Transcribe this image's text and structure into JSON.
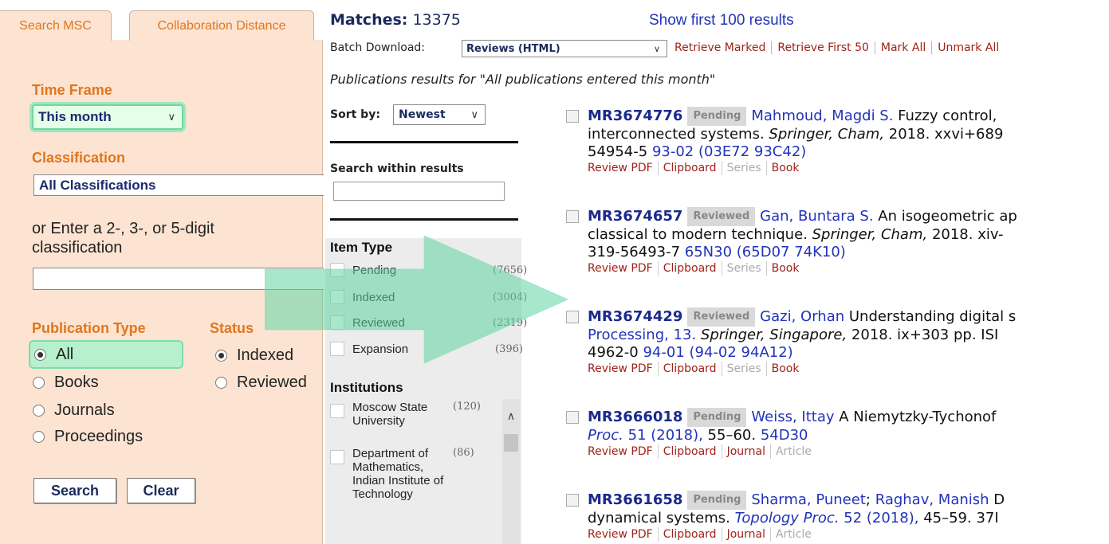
{
  "left": {
    "tabs": [
      "Search MSC",
      "Collaboration Distance"
    ],
    "time_frame": {
      "title": "Time Frame",
      "selected": "This month"
    },
    "classification": {
      "title": "Classification",
      "selected": "All Classifications"
    },
    "enter_classification": {
      "line1": "or Enter a 2-, 3-, or 5-digit",
      "line2": "classification",
      "value": ""
    },
    "publication_type": {
      "title": "Publication Type",
      "options": [
        "All",
        "Books",
        "Journals",
        "Proceedings"
      ],
      "selected": "All"
    },
    "status": {
      "title": "Status",
      "options": [
        "Indexed",
        "Reviewed"
      ],
      "selected": "Indexed"
    },
    "buttons": {
      "search": "Search",
      "clear": "Clear"
    }
  },
  "header": {
    "matches_label": "Matches:",
    "matches_count": "13375",
    "show_first": "Show first 100 results",
    "batch_label": "Batch Download:",
    "batch_selected": "Reviews (HTML)",
    "batch_actions": [
      "Retrieve Marked",
      "Retrieve First 50",
      "Mark All",
      "Unmark All"
    ],
    "results_caption": "Publications results for \"All publications entered this month\""
  },
  "filters": {
    "sort_label": "Sort by:",
    "sort_selected": "Newest",
    "search_within_label": "Search within results",
    "item_type_title": "Item Type",
    "item_types": [
      {
        "label": "Pending",
        "count": "(7656)"
      },
      {
        "label": "Indexed",
        "count": "(3004)"
      },
      {
        "label": "Reviewed",
        "count": "(2319)"
      },
      {
        "label": "Expansion",
        "count": "(396)"
      }
    ],
    "institutions_title": "Institutions",
    "institutions": [
      {
        "label": "Moscow State University",
        "count": "(120)"
      },
      {
        "label": "Department of Mathematics, Indian Institute of Technology",
        "count": "(86)"
      }
    ]
  },
  "results": [
    {
      "mr": "MR3674776",
      "status": "Pending",
      "author": "Mahmoud, Magdi S.",
      "line1_rest": " Fuzzy control,",
      "line2": "interconnected systems. ",
      "line2_ital": "Springer, Cham,",
      "line2_rest": " 2018. xxvi+689",
      "line3_plain": "54954-5 ",
      "line3_blue": "93-02 (03E72 93C42)",
      "links": [
        "Review PDF",
        "Clipboard",
        "Series",
        "Book"
      ]
    },
    {
      "mr": "MR3674657",
      "status": "Reviewed",
      "author": "Gan, Buntara S.",
      "line1_rest": " An isogeometric ap",
      "line2": "classical to modern technique. ",
      "line2_ital": "Springer, Cham,",
      "line2_rest": " 2018. xiv-",
      "line3_plain": "319-56493-7 ",
      "line3_blue": "65N30 (65D07 74K10)",
      "links": [
        "Review PDF",
        "Clipboard",
        "Series",
        "Book"
      ]
    },
    {
      "mr": "MR3674429",
      "status": "Reviewed",
      "author": "Gazi, Orhan",
      "line1_rest": " Understanding digital s",
      "line2_blue": "Processing, 13.",
      "line2_ital": " Springer, Singapore,",
      "line2_rest": " 2018. ix+303 pp. ISI",
      "line3_plain": "4962-0 ",
      "line3_blue": "94-01 (94-02 94A12)",
      "links": [
        "Review PDF",
        "Clipboard",
        "Series",
        "Book"
      ]
    },
    {
      "mr": "MR3666018",
      "status": "Pending",
      "author": "Weiss, Ittay",
      "line1_rest": " A Niemytzky-Tychonof",
      "line2_ital_blue": "Proc.",
      "line2_blue": " 51 (2018),",
      "line2_rest": " 55–60. ",
      "line2_code": "54D30",
      "links": [
        "Review PDF",
        "Clipboard",
        "Journal",
        "Article"
      ]
    },
    {
      "mr": "MR3661658",
      "status": "Pending",
      "author": "Sharma, Puneet",
      "author2": "Raghav, Manish",
      "line1_rest": " D",
      "line2": "dynamical systems. ",
      "line2_ital_blue": "Topology Proc.",
      "line2_blue": " 52 (2018),",
      "line2_rest": " 45–59. 37I",
      "links": [
        "Review PDF",
        "Clipboard",
        "Journal",
        "Article"
      ]
    }
  ]
}
